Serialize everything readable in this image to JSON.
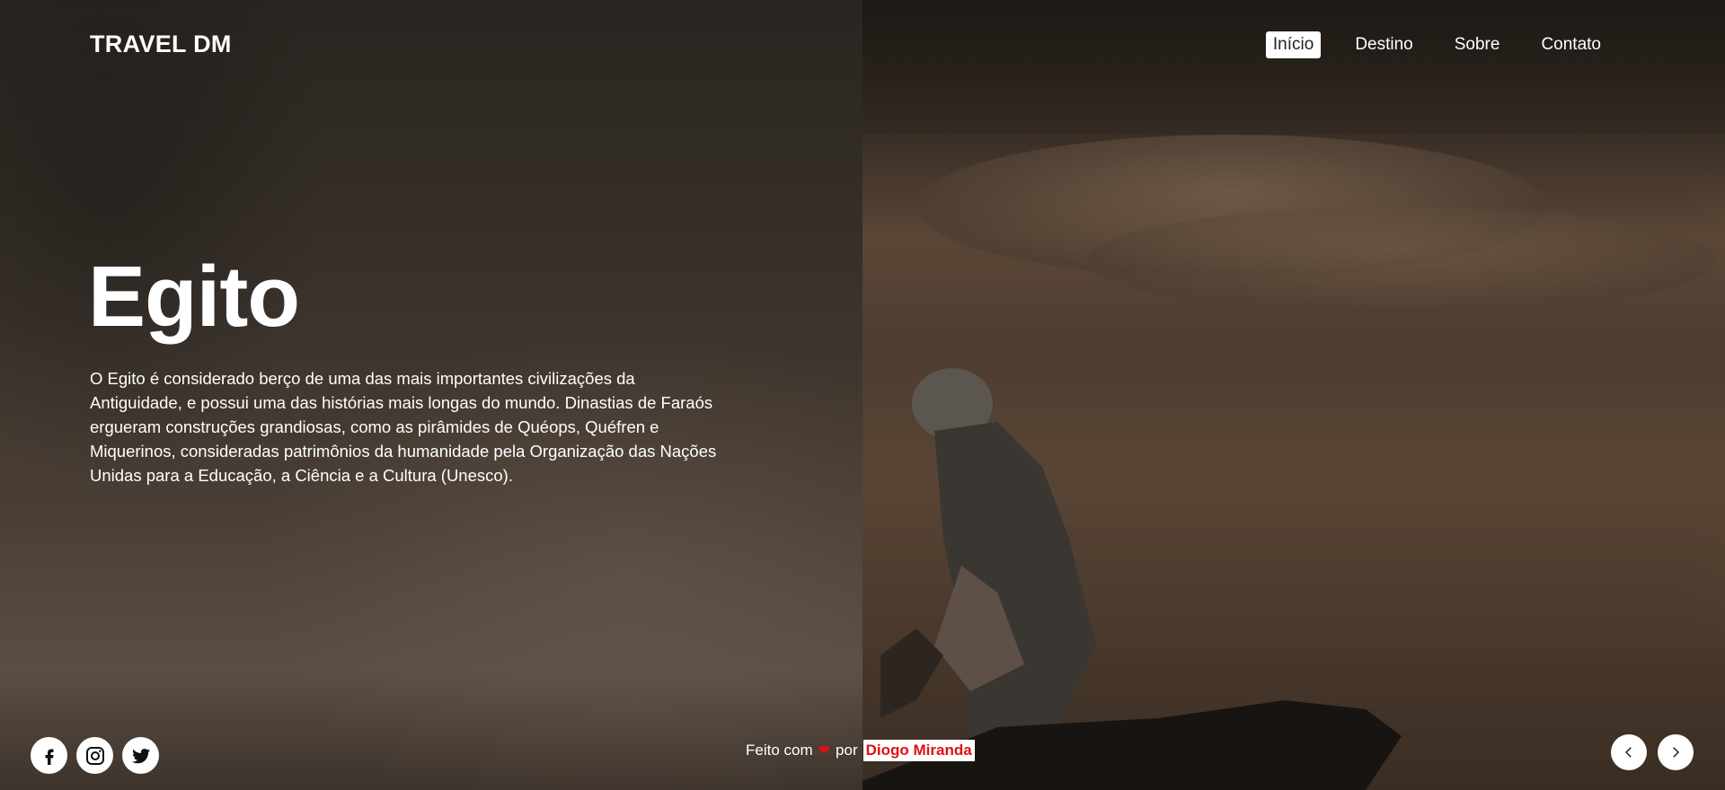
{
  "header": {
    "brand": "TRAVEL DM",
    "nav": [
      {
        "label": "Início",
        "active": true
      },
      {
        "label": "Destino",
        "active": false
      },
      {
        "label": "Sobre",
        "active": false
      },
      {
        "label": "Contato",
        "active": false
      }
    ]
  },
  "hero": {
    "title": "Egito",
    "description": "O Egito é considerado berço de uma das mais importantes civilizações da Antiguidade, e possui uma das histórias mais longas do mundo. Dinastias de Faraós ergueram construções grandiosas, como as pirâmides de Quéops, Quéfren e Miquerinos, consideradas patrimônios da humanidade pela Organização das Nações Unidas para a Educação, a Ciência e a Cultura (Unesco)."
  },
  "footer": {
    "social": [
      {
        "icon": "facebook-icon"
      },
      {
        "icon": "instagram-icon"
      },
      {
        "icon": "twitter-icon"
      }
    ],
    "credit": {
      "prefix": "Feito com",
      "heart": "❤",
      "by": "por",
      "author": "Diogo Miranda"
    },
    "arrows": [
      {
        "icon": "chevron-left-icon"
      },
      {
        "icon": "chevron-right-icon"
      }
    ]
  },
  "colors": {
    "heart": "#e01010",
    "author_text": "#e01010",
    "nav_active_bg": "#ffffff"
  }
}
